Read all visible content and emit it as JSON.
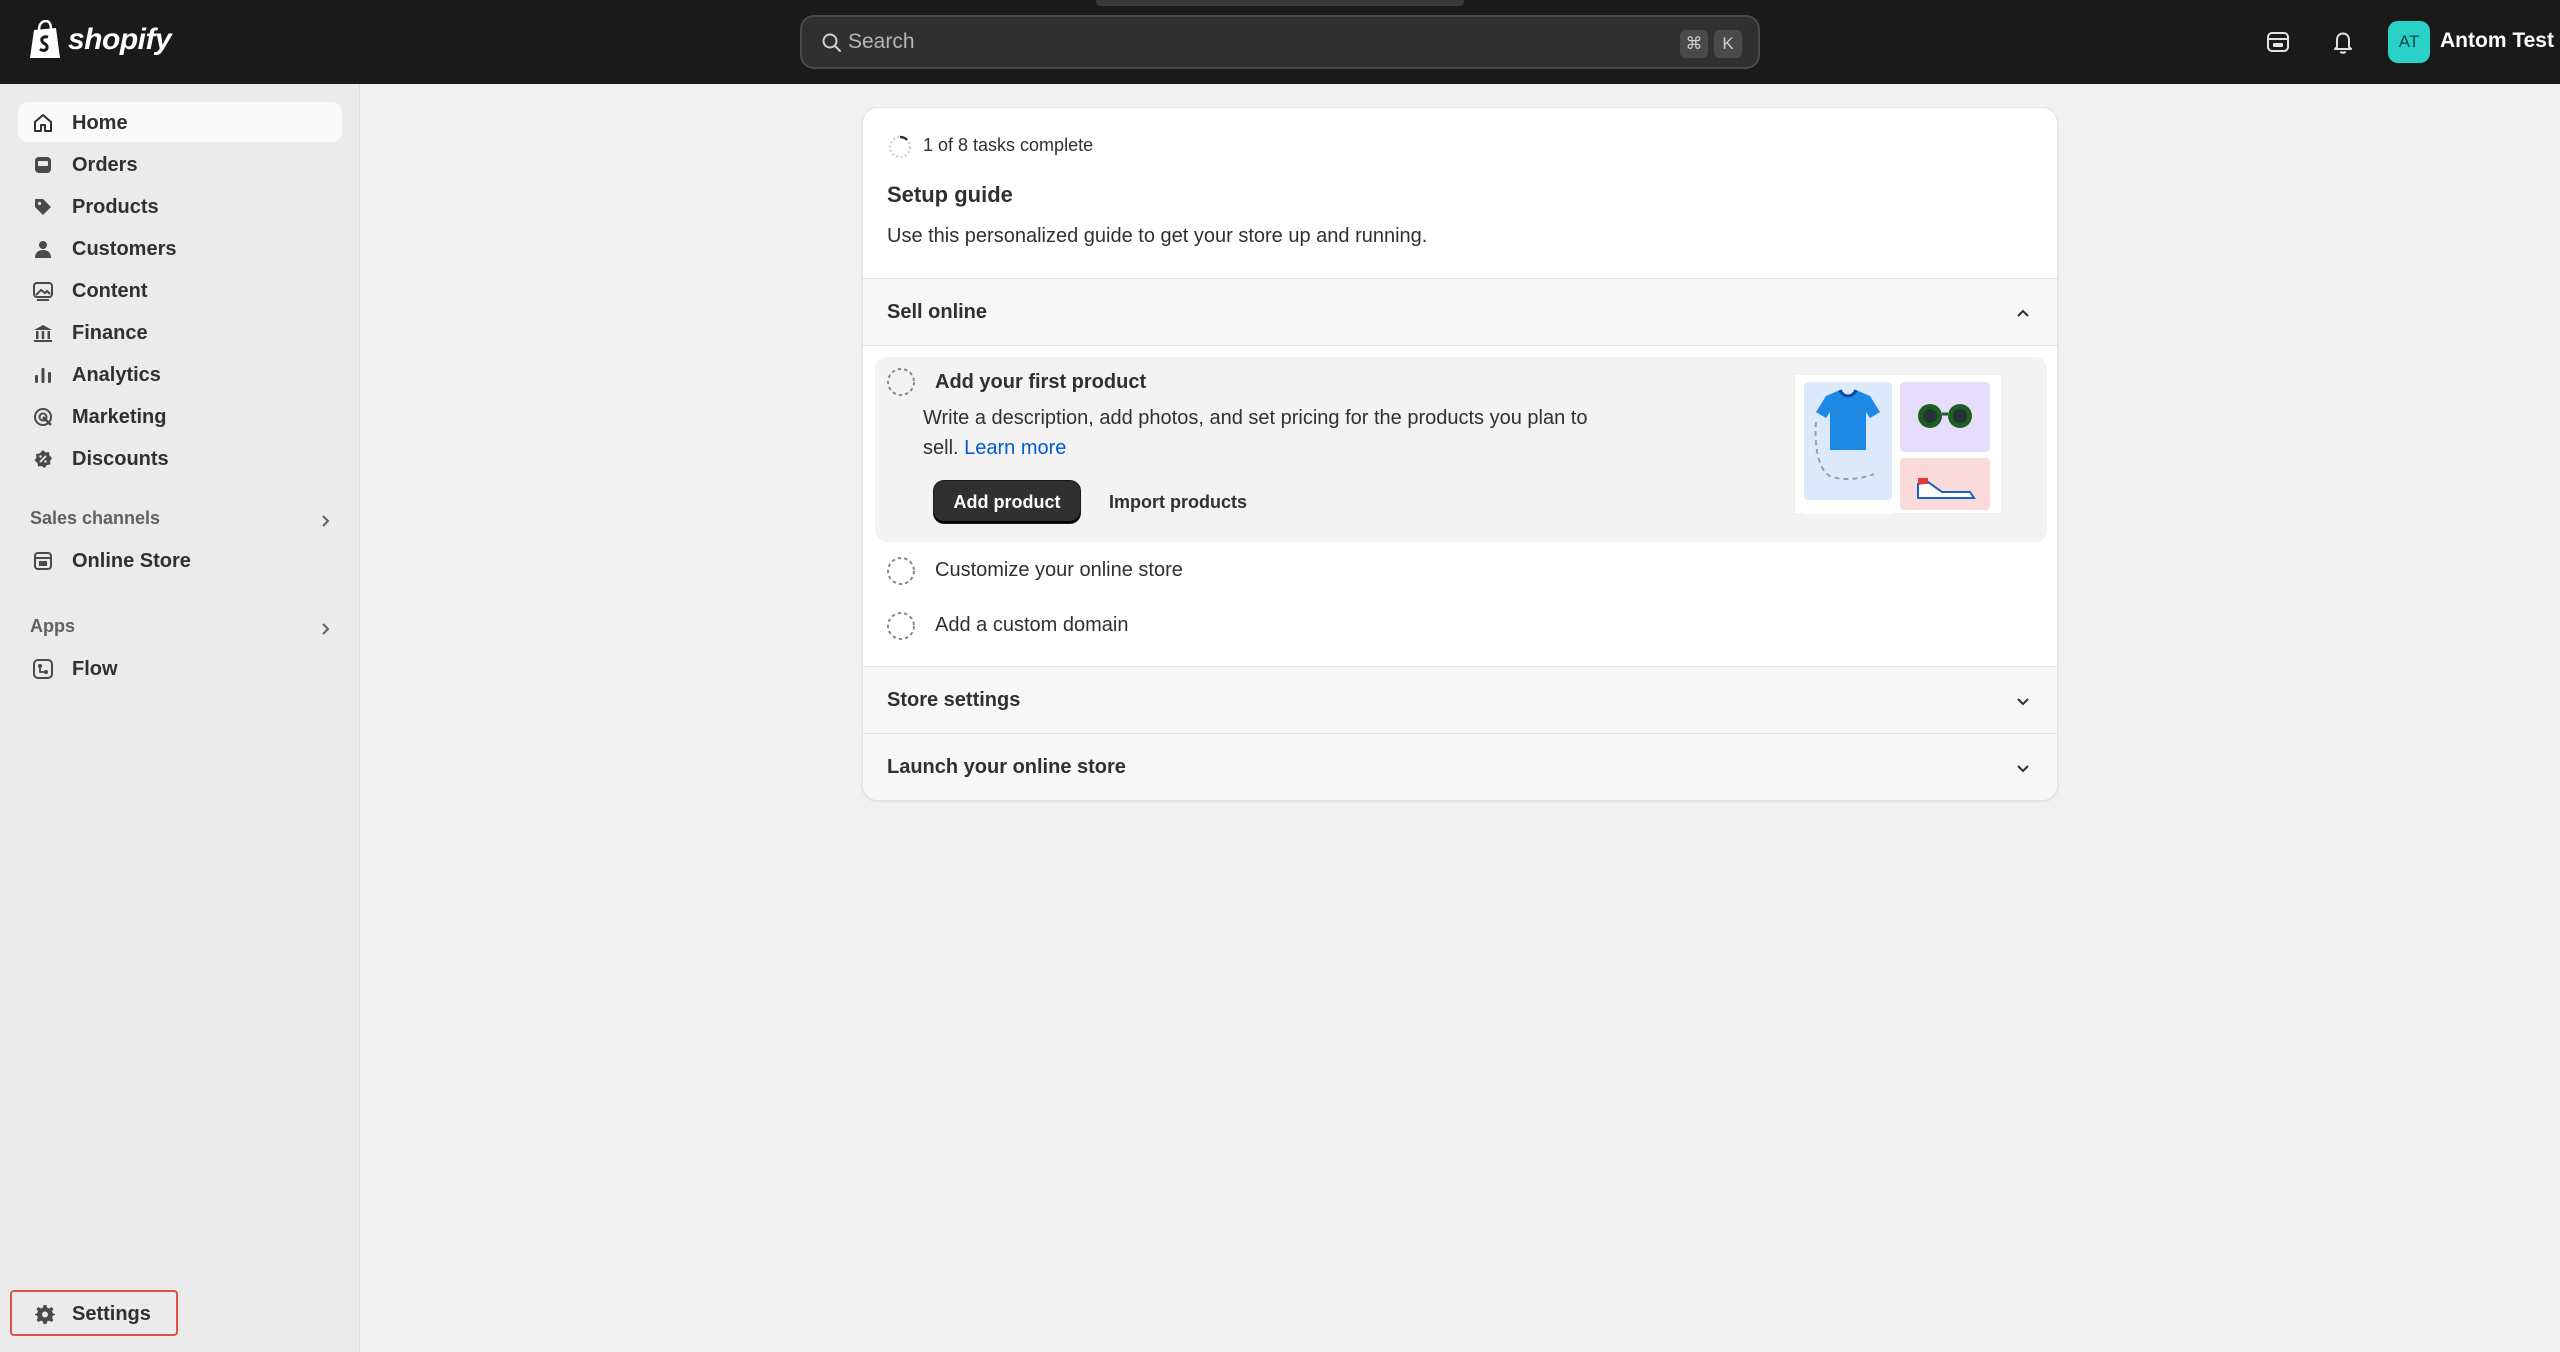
{
  "topbar": {
    "brand": "shopify",
    "search_placeholder": "Search",
    "shortcut_cmd": "⌘",
    "shortcut_key": "K",
    "avatar_initials": "AT",
    "username": "Antom Test"
  },
  "sidebar": {
    "items": [
      {
        "label": "Home",
        "icon": "home-icon",
        "active": true
      },
      {
        "label": "Orders",
        "icon": "inbox-icon"
      },
      {
        "label": "Products",
        "icon": "tag-icon"
      },
      {
        "label": "Customers",
        "icon": "person-icon"
      },
      {
        "label": "Content",
        "icon": "image-icon"
      },
      {
        "label": "Finance",
        "icon": "bank-icon"
      },
      {
        "label": "Analytics",
        "icon": "bar-chart-icon"
      },
      {
        "label": "Marketing",
        "icon": "target-icon"
      },
      {
        "label": "Discounts",
        "icon": "discount-icon"
      }
    ],
    "sales_channels_label": "Sales channels",
    "sales_channels": [
      {
        "label": "Online Store",
        "icon": "store-icon"
      }
    ],
    "apps_label": "Apps",
    "apps": [
      {
        "label": "Flow",
        "icon": "flow-icon"
      }
    ],
    "settings_label": "Settings"
  },
  "setup_guide": {
    "progress_text": "1 of 8 tasks complete",
    "progress_fraction": 0.125,
    "title": "Setup guide",
    "description": "Use this personalized guide to get your store up and running.",
    "sections": [
      {
        "label": "Sell online",
        "expanded": true,
        "tasks": [
          {
            "title": "Add your first product",
            "description": "Write a description, add photos, and set pricing for the products you plan to sell.",
            "link": "Learn more",
            "primary_action": "Add product",
            "secondary_action": "Import products"
          },
          {
            "title": "Customize your online store"
          },
          {
            "title": "Add a custom domain"
          }
        ]
      },
      {
        "label": "Store settings",
        "expanded": false
      },
      {
        "label": "Launch your online store",
        "expanded": false
      }
    ]
  },
  "colors": {
    "topbar": "#1a1a1a",
    "background": "#f1f1f1",
    "primary_button": "#303030",
    "link": "#005bd3",
    "avatar": "#2ad1c8",
    "settings_highlight": "#e2504c"
  }
}
